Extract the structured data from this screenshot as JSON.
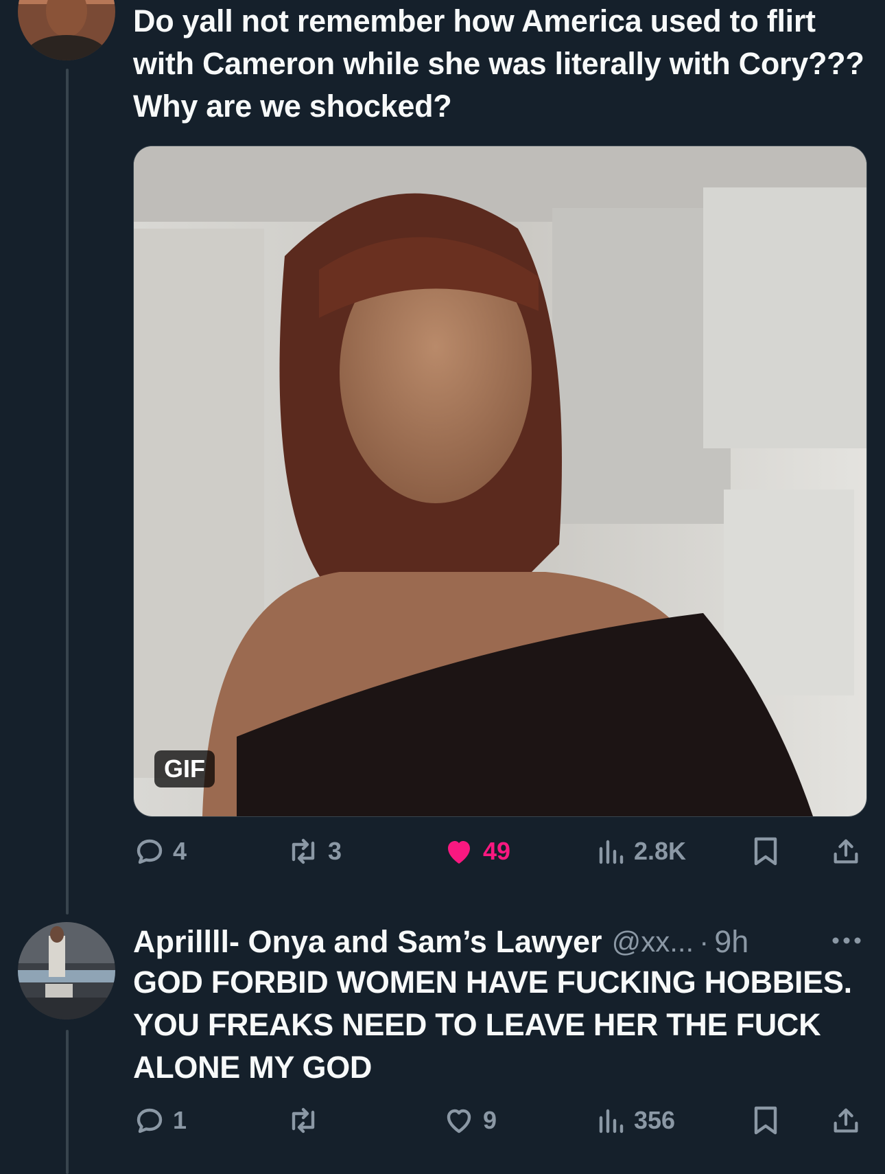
{
  "tweet1": {
    "text": "Do yall not remember how America used to flirt with Cameron while she was literally with Cory??? Why are we shocked?",
    "media_badge": "GIF",
    "actions": {
      "replies": "4",
      "reposts": "3",
      "likes": "49",
      "views": "2.8K"
    }
  },
  "tweet2": {
    "author_name": "Aprillll- Onya and Sam’s Lawyer",
    "handle": "@xx...",
    "separator": "·",
    "time": "9h",
    "text": "GOD FORBID WOMEN HAVE FUCKING HOBBIES. YOU FREAKS NEED TO LEAVE HER THE FUCK ALONE MY GOD",
    "actions": {
      "replies": "1",
      "reposts": "",
      "likes": "9",
      "views": "356"
    }
  },
  "colors": {
    "background": "#15202b",
    "text_primary": "#f7f9f9",
    "text_secondary": "#8b98a5",
    "like_active": "#f91880",
    "thread_line": "#38444d"
  },
  "icons": [
    "reply-icon",
    "repost-icon",
    "like-icon",
    "views-icon",
    "bookmark-icon",
    "share-icon",
    "more-icon"
  ]
}
